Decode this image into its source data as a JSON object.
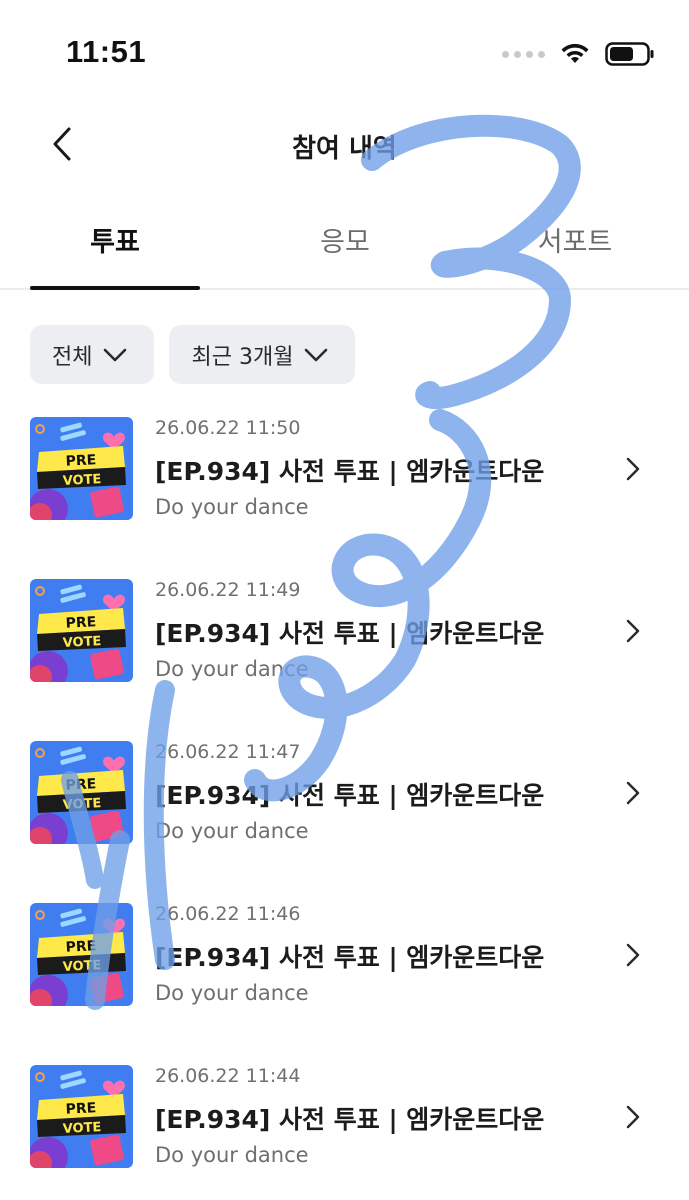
{
  "status_bar": {
    "time": "11:51",
    "icons": [
      "signal-icon",
      "wifi-icon",
      "battery-icon"
    ]
  },
  "nav": {
    "title": "참여 내역",
    "back_icon": "chevron-left-icon"
  },
  "tabs": [
    {
      "label": "투표",
      "active": true
    },
    {
      "label": "응모",
      "active": false
    },
    {
      "label": "서포트",
      "active": false
    }
  ],
  "filters": [
    {
      "label": "전체",
      "icon": "chevron-down-icon"
    },
    {
      "label": "최근 3개월",
      "icon": "chevron-down-icon"
    }
  ],
  "thumbnail": {
    "line1": "PRE",
    "line2": "VOTE"
  },
  "items": [
    {
      "date": "26.06.22 11:50",
      "title": "[EP.934] 사전 투표 | 엠카운트다운",
      "subtitle": "Do your dance"
    },
    {
      "date": "26.06.22 11:49",
      "title": "[EP.934] 사전 투표 | 엠카운트다운",
      "subtitle": "Do your dance"
    },
    {
      "date": "26.06.22 11:47",
      "title": "[EP.934] 사전 투표 | 엠카운트다운",
      "subtitle": "Do your dance"
    },
    {
      "date": "26.06.22 11:46",
      "title": "[EP.934] 사전 투표 | 엠카운트다운",
      "subtitle": "Do your dance"
    },
    {
      "date": "26.06.22 11:44",
      "title": "[EP.934] 사전 투표 | 엠카운트다운",
      "subtitle": "Do your dance"
    }
  ],
  "colors": {
    "accent": "#111111",
    "chip_bg": "#eceef2",
    "doodle": "#6f9fe8"
  }
}
